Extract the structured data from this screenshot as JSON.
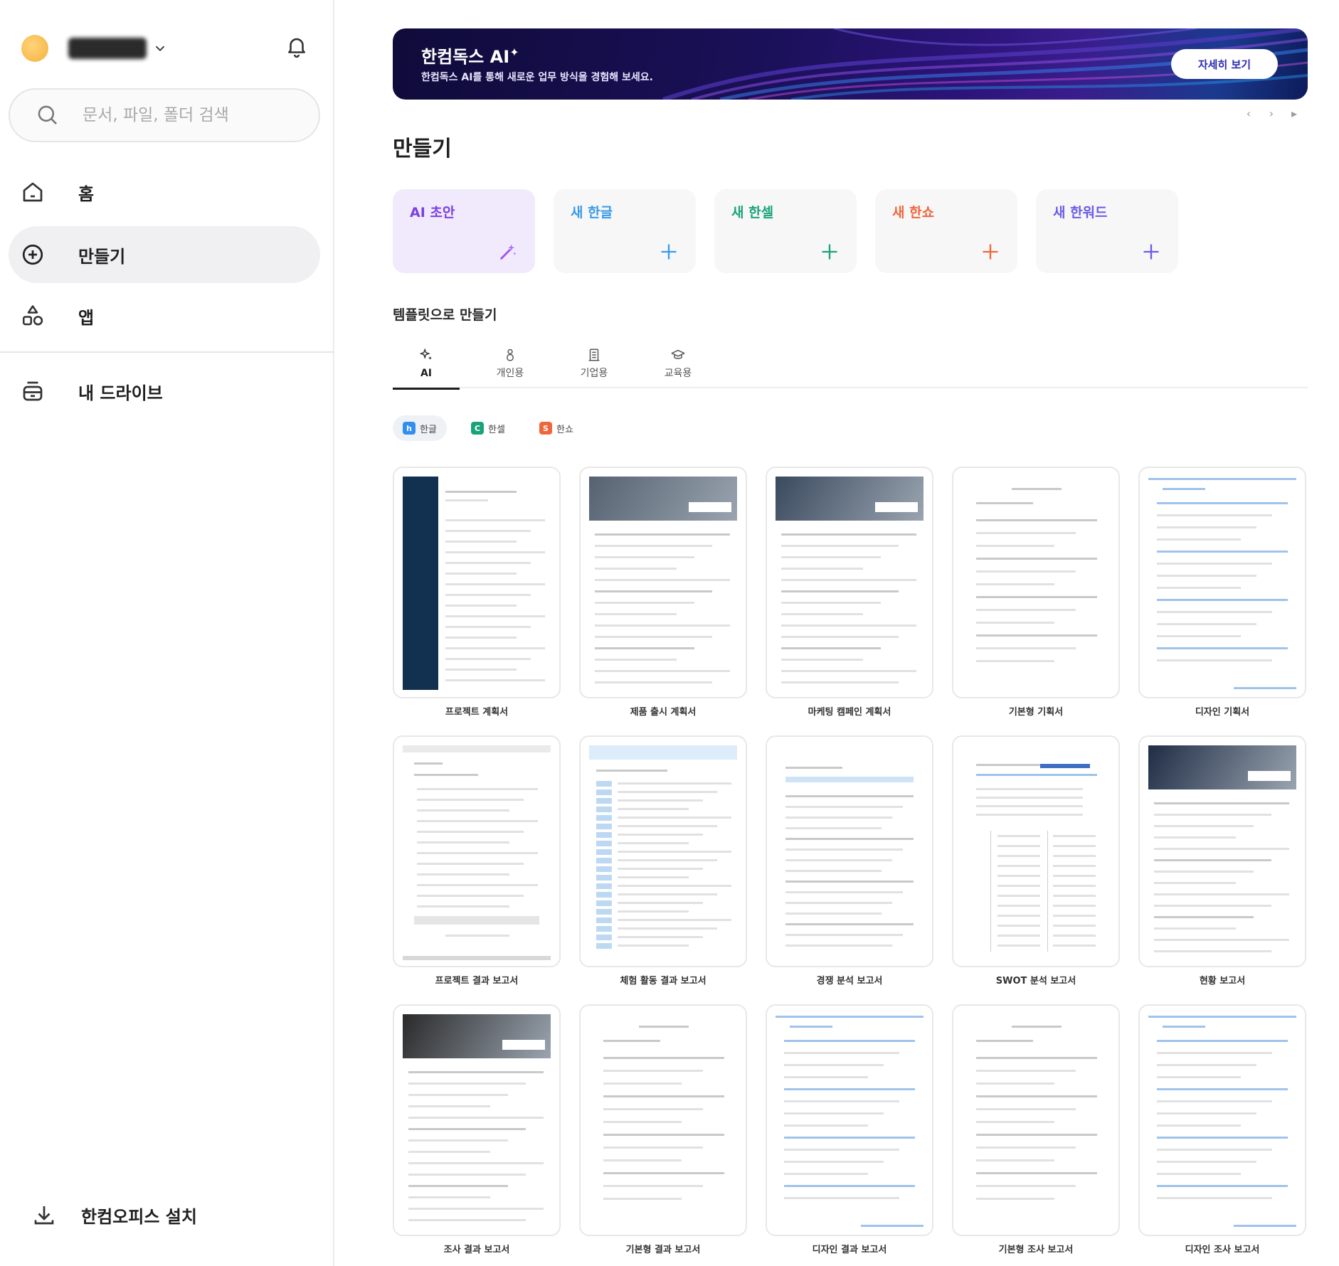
{
  "sidebar": {
    "search_placeholder": "문서, 파일, 폴더 검색",
    "nav": [
      {
        "label": "홈",
        "icon": "home-icon"
      },
      {
        "label": "만들기",
        "icon": "plus-circle-icon",
        "active": true
      },
      {
        "label": "앱",
        "icon": "apps-icon"
      },
      {
        "label": "내 드라이브",
        "icon": "drive-icon"
      }
    ],
    "install_label": "한컴오피스 설치"
  },
  "banner": {
    "title": "한컴독스 AI",
    "subtitle": "한컴독스 AI를 통해 새로운 업무 방식을 경험해 보세요.",
    "button": "자세히 보기"
  },
  "pager": {
    "prev": "‹",
    "next": "›",
    "play": "▸"
  },
  "create": {
    "heading": "만들기",
    "cards": [
      {
        "label": "AI 초안",
        "color": "#7b3fe4",
        "icon": "magic-wand-icon"
      },
      {
        "label": "새 한글",
        "color": "#3a9be8",
        "icon": "plus-icon"
      },
      {
        "label": "새 한셀",
        "color": "#1aa37a",
        "icon": "plus-icon"
      },
      {
        "label": "새 한쇼",
        "color": "#f0663b",
        "icon": "plus-icon"
      },
      {
        "label": "새 한워드",
        "color": "#6a5be8",
        "icon": "plus-icon"
      }
    ]
  },
  "templates": {
    "heading": "템플릿으로 만들기",
    "tabs": [
      {
        "label": "AI",
        "icon": "sparkle-icon",
        "active": true
      },
      {
        "label": "개인용",
        "icon": "person-icon"
      },
      {
        "label": "기업용",
        "icon": "building-icon"
      },
      {
        "label": "교육용",
        "icon": "graduation-cap-icon"
      }
    ],
    "apps": [
      {
        "label": "한글",
        "badge": "h",
        "color": "#2f8ff0",
        "active": true
      },
      {
        "label": "한셀",
        "badge": "C",
        "color": "#1aa37a"
      },
      {
        "label": "한쇼",
        "badge": "S",
        "color": "#f0663b"
      }
    ],
    "items": [
      "프로젝트 계획서",
      "제품 출시 계획서",
      "마케팅 캠페인 계획서",
      "기본형 기획서",
      "디자인 기획서",
      "프로젝트 결과 보고서",
      "체험 활동 결과 보고서",
      "경쟁 분석 보고서",
      "SWOT 분석 보고서",
      "현황 보고서",
      "조사 결과 보고서",
      "기본형 결과 보고서",
      "디자인 결과 보고서",
      "기본형 조사 보고서",
      "디자인 조사 보고서"
    ]
  }
}
